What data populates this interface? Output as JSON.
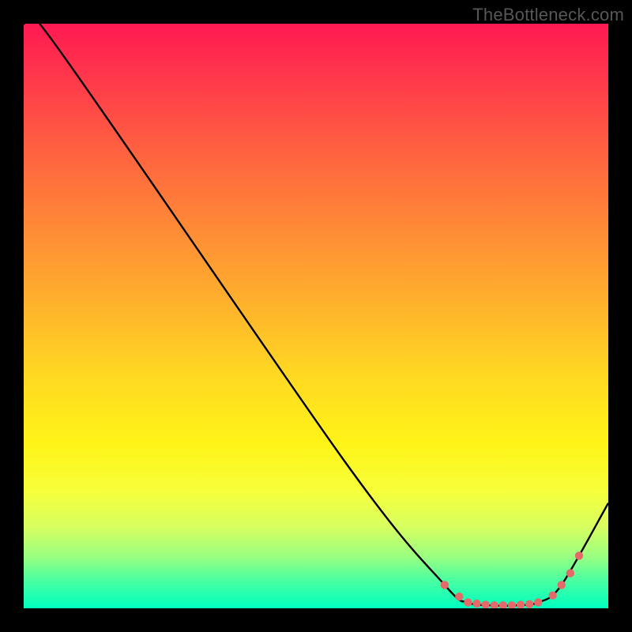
{
  "watermark": "TheBottleneck.com",
  "chart_data": {
    "type": "line",
    "title": "",
    "xlabel": "",
    "ylabel": "",
    "xlim": [
      0,
      100
    ],
    "ylim": [
      0,
      100
    ],
    "series": [
      {
        "name": "bottleneck-curve",
        "x": [
          0,
          5,
          55,
          72,
          76,
          80,
          84,
          88,
          92,
          100
        ],
        "y": [
          100,
          97,
          25,
          4,
          1,
          0.5,
          0.5,
          1,
          4,
          18
        ]
      }
    ],
    "markers": {
      "name": "bead-points",
      "color": "#e46a6a",
      "x": [
        72,
        74.5,
        76,
        77.5,
        79,
        80.5,
        82,
        83.5,
        85,
        86.5,
        88,
        90.5,
        92,
        93.5,
        95
      ],
      "y": [
        4,
        2,
        1,
        0.8,
        0.6,
        0.5,
        0.5,
        0.5,
        0.6,
        0.7,
        1,
        2.2,
        4,
        6,
        9
      ]
    },
    "gradient_stops": [
      {
        "pct": 0,
        "color": "#ff1a52"
      },
      {
        "pct": 50,
        "color": "#ffe020"
      },
      {
        "pct": 100,
        "color": "#00ffc0"
      }
    ]
  }
}
